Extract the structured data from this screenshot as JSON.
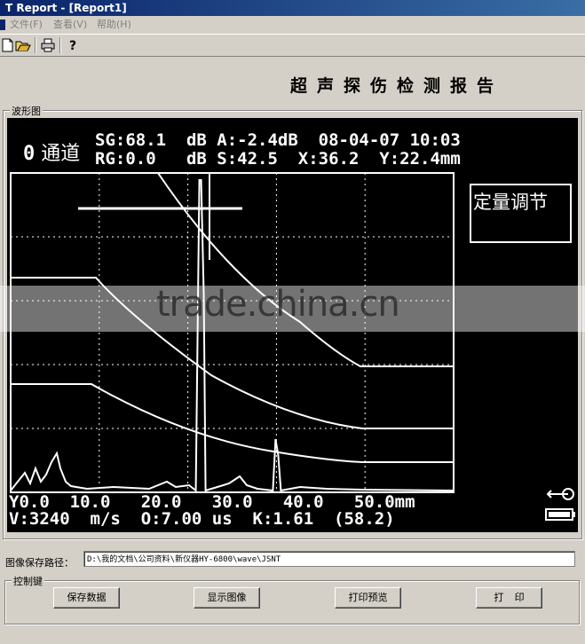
{
  "window": {
    "title": "T Report - [Report1]"
  },
  "menu": {
    "items": [
      "文件(F)",
      "查看(V)",
      "帮助(H)"
    ]
  },
  "toolbar": {
    "icons": [
      "new-file-icon",
      "open-folder-icon",
      "print-icon",
      "help-icon"
    ]
  },
  "report": {
    "title": "超声探伤检测报告"
  },
  "waveform": {
    "group_label": "波形图",
    "channel": {
      "number": "0",
      "label": "通道"
    },
    "line1": "SG:68.1  dB A:-2.4dB  08-04-07 10:03",
    "line2": "RG:0.0   dB S:42.5  X:36.2  Y:22.4mm",
    "quant_box": "定量调节",
    "axis_line": "Y0.0  10.0   20.0   30.0   40.0   50.0mm",
    "bottom_line": "V:3240  m/s  O:7.00 us  K:1.61  (58.2)",
    "chart_data": {
      "type": "line",
      "x": [
        0,
        10,
        20,
        30,
        40,
        50
      ],
      "xunit": "mm",
      "xlim": [
        0,
        50
      ],
      "peaks_x": [
        21.5,
        30.0
      ],
      "grid": true
    },
    "colors": {
      "screen": "#000000",
      "trace": "#ffffff"
    }
  },
  "watermark": "trade.china.cn",
  "save_path": {
    "label": "图像保存路径：",
    "value": "D:\\我的文档\\公司资料\\新仪器HY-6800\\wave\\JSNT"
  },
  "controls": {
    "group_label": "控制键",
    "save": "保存数据",
    "show": "显示图像",
    "preview": "打印预览",
    "print": "打    印"
  }
}
